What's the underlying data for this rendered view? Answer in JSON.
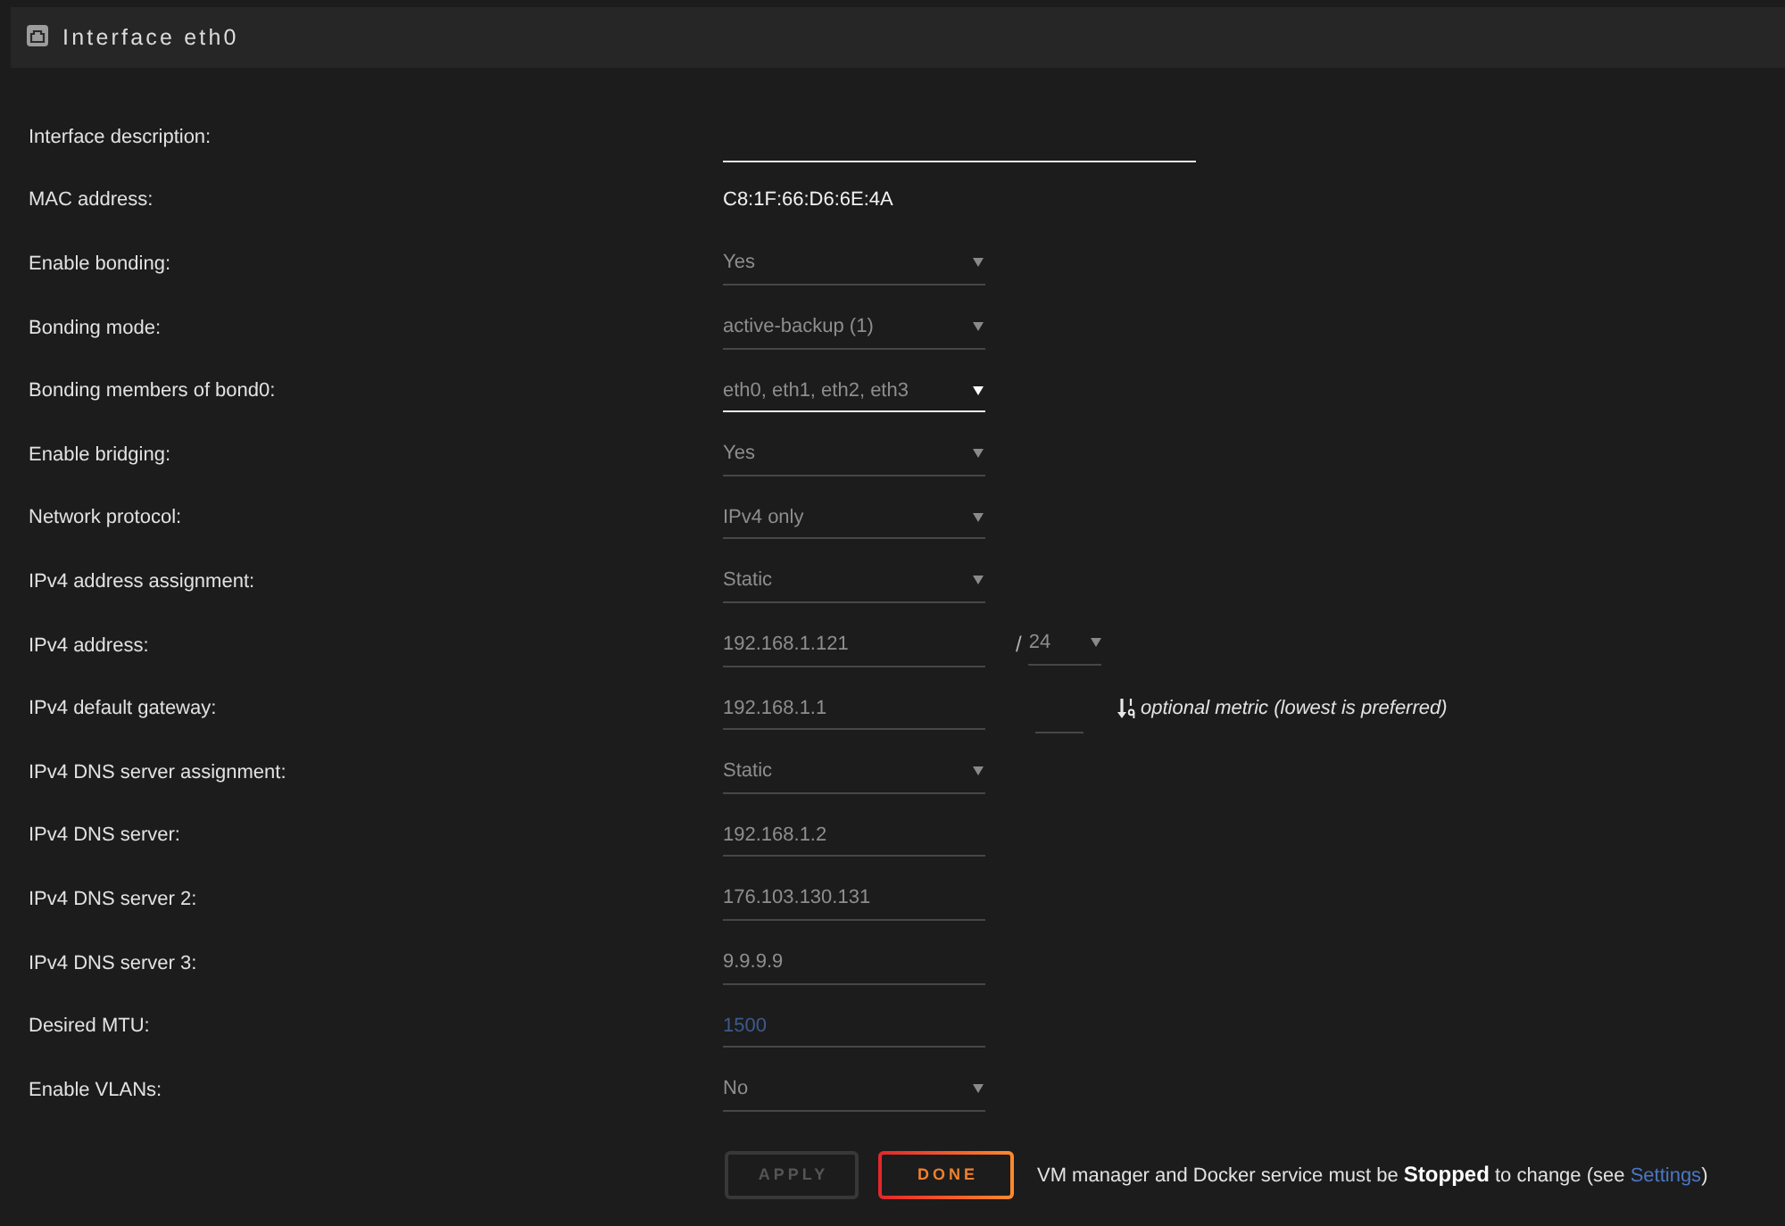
{
  "panel": {
    "title": "Interface eth0"
  },
  "fields": [
    {
      "label": "Interface description:",
      "kind": "text",
      "disabled": false
    },
    {
      "label": "MAC address:",
      "kind": "static",
      "value": "C8:1F:66:D6:6E:4A",
      "disabled": false
    },
    {
      "label": "Enable bonding:",
      "kind": "select",
      "value": "Yes",
      "disabled": true
    },
    {
      "label": "Bonding mode:",
      "kind": "select",
      "value": "active-backup (1)",
      "disabled": true
    },
    {
      "label": "Bonding members of bond0:",
      "kind": "select",
      "value": "eth0, eth1, eth2, eth3",
      "disabled": false
    },
    {
      "label": "Enable bridging:",
      "kind": "select",
      "value": "Yes",
      "disabled": true
    },
    {
      "label": "Network protocol:",
      "kind": "select",
      "value": "IPv4 only",
      "disabled": true
    },
    {
      "label": "IPv4 address assignment:",
      "kind": "select",
      "value": "Static",
      "disabled": true
    },
    {
      "label": "IPv4 address:",
      "kind": "address",
      "value": "192.168.1.121",
      "separator": "/",
      "prefix": "24",
      "disabled": true
    },
    {
      "label": "IPv4 default gateway:",
      "kind": "gateway",
      "value": "192.168.1.1",
      "hint": "optional metric (lowest is preferred)",
      "disabled": true
    },
    {
      "label": "IPv4 DNS server assignment:",
      "kind": "select",
      "value": "Static",
      "disabled": true
    },
    {
      "label": "IPv4 DNS server:",
      "kind": "input",
      "value": "192.168.1.2",
      "disabled": true
    },
    {
      "label": "IPv4 DNS server 2:",
      "kind": "input",
      "value": "176.103.130.131",
      "disabled": true
    },
    {
      "label": "IPv4 DNS server 3:",
      "kind": "input",
      "value": "9.9.9.9",
      "disabled": true
    },
    {
      "label": "Desired MTU:",
      "kind": "input",
      "placeholder": "1500",
      "disabled": true
    },
    {
      "label": "Enable VLANs:",
      "kind": "select",
      "value": "No",
      "disabled": true
    }
  ],
  "actions": {
    "buttons": [
      {
        "label": "APPLY",
        "disabled": true
      },
      {
        "label": "DONE",
        "disabled": false
      }
    ],
    "note": {
      "text": "VM manager and Docker service must be **Stopped** to change (see ",
      "link": "Settings",
      "after": ")"
    }
  }
}
